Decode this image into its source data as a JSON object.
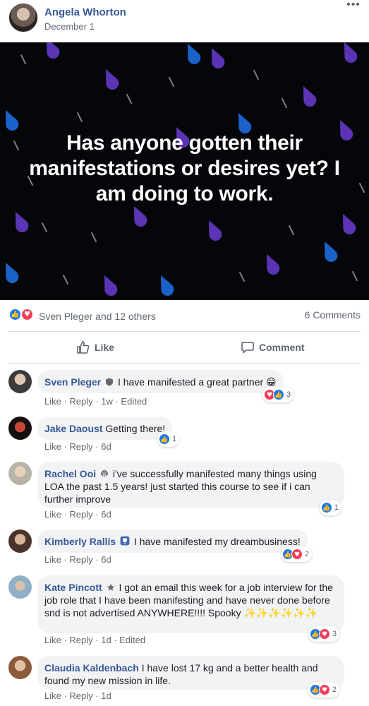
{
  "post": {
    "author": "Angela Whorton",
    "date": "December 1",
    "more_icon": "•••",
    "image_text": "Has anyone gotten their manifestations or desires yet? I am doing to work.",
    "image_colors": {
      "background": "#05060a",
      "purple": "#5b34b6",
      "blue": "#1a62c9",
      "gray": "#7b7d85"
    }
  },
  "reactions": {
    "summary": "Sven Pleger and 12 others",
    "comments_count": "6 Comments",
    "like_color": "#1877f2",
    "love_color": "#f33e58"
  },
  "actions": {
    "like": "Like",
    "comment": "Comment"
  },
  "comments": [
    {
      "name": "Sven Pleger",
      "badge": "shield-icon",
      "text": "I have manifested a great partner 😁",
      "meta_like": "Like",
      "meta_reply": "Reply",
      "time": "1w",
      "edited": "Edited",
      "reaction_count": "3",
      "reactions": [
        "love",
        "like"
      ]
    },
    {
      "name": "Jake Daoust",
      "badge": "",
      "text": "Getting there!",
      "meta_like": "Like",
      "meta_reply": "Reply",
      "time": "6d",
      "edited": "",
      "reaction_count": "1",
      "reactions": [
        "like"
      ]
    },
    {
      "name": "Rachel Ooi",
      "badge": "shell-icon",
      "text": "i've successfully manifested many things using LOA the past 1.5 years! just started this course to see if i can further improve",
      "meta_like": "Like",
      "meta_reply": "Reply",
      "time": "6d",
      "edited": "",
      "reaction_count": "1",
      "reactions": [
        "like"
      ]
    },
    {
      "name": "Kimberly Rallis",
      "badge": "trophy-icon",
      "text": "I have manifested my dreambusiness!",
      "meta_like": "Like",
      "meta_reply": "Reply",
      "time": "6d",
      "edited": "",
      "reaction_count": "2",
      "reactions": [
        "like",
        "love"
      ]
    },
    {
      "name": "Kate Pincott",
      "badge": "star-icon",
      "text": "I got an email this week for a job interview for the job role that I have been manifesting and have never done before snd is not advertised ANYWHERE!!!! Spooky ✨✨✨✨✨✨",
      "meta_like": "Like",
      "meta_reply": "Reply",
      "time": "1d",
      "edited": "Edited",
      "reaction_count": "3",
      "reactions": [
        "like",
        "love"
      ]
    },
    {
      "name": "Claudia Kaldenbach",
      "badge": "",
      "text": "I have lost 17 kg and a better health and found my new mission in life.",
      "meta_like": "Like",
      "meta_reply": "Reply",
      "time": "1d",
      "edited": "",
      "reaction_count": "2",
      "reactions": [
        "like",
        "love"
      ]
    }
  ]
}
